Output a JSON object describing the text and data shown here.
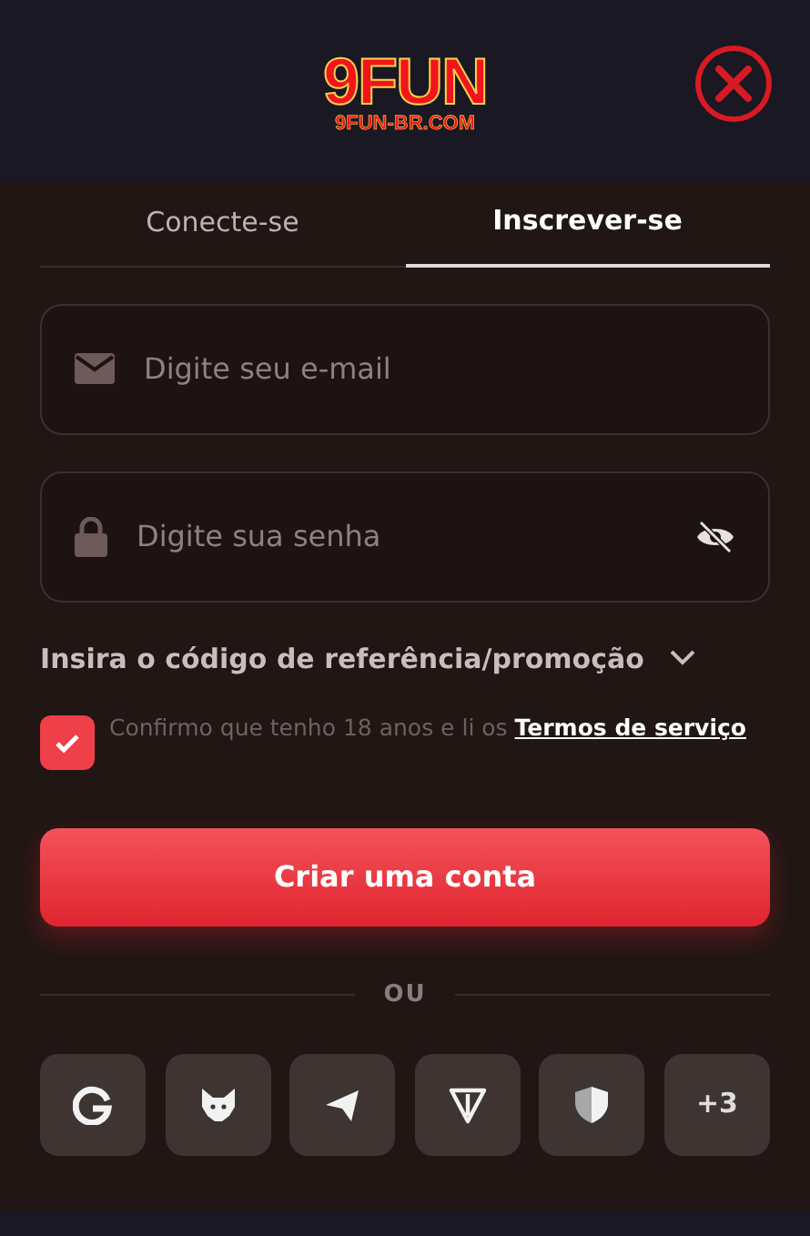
{
  "header": {
    "logo": "9FUN",
    "logo_sub": "9FUN-BR.COM"
  },
  "tabs": [
    {
      "label": "Conecte-se",
      "selected": false
    },
    {
      "label": "Inscrever-se",
      "selected": true
    }
  ],
  "fields": [
    {
      "kind": "email",
      "placeholder": "Digite seu e-mail"
    },
    {
      "kind": "password",
      "placeholder": "Digite sua senha"
    }
  ],
  "referral": {
    "label": "Insira o código de referência/promoção",
    "expanded": false
  },
  "terms": {
    "checked": true,
    "text": "Confirmo que tenho 18 anos e li os",
    "link": "Termos de serviço"
  },
  "submit": "Criar uma conta",
  "divider": "OU",
  "social": [
    {
      "kind": "g"
    },
    {
      "kind": "fox"
    },
    {
      "kind": "plane"
    },
    {
      "kind": "ton"
    },
    {
      "kind": "shield"
    },
    {
      "kind": "more",
      "label": "+3"
    }
  ]
}
